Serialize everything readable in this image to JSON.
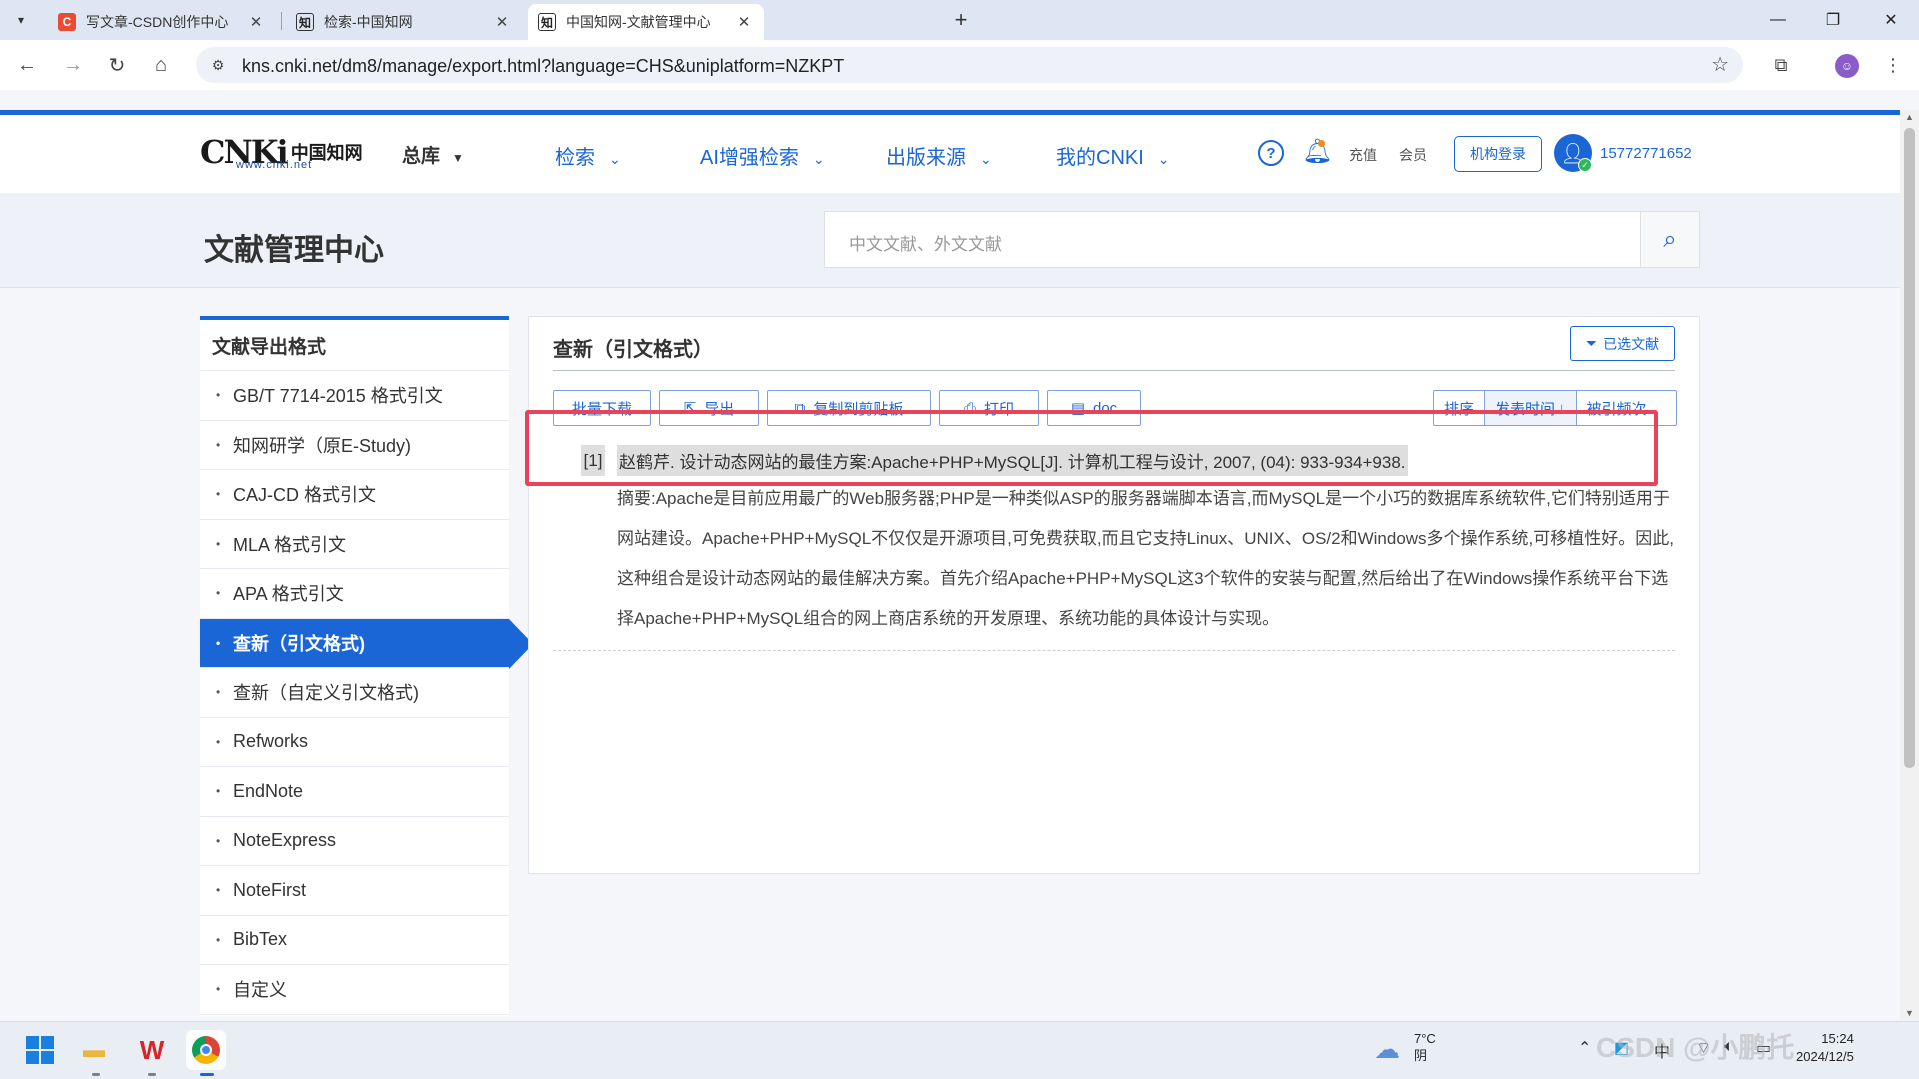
{
  "browser": {
    "tabs": [
      {
        "title": "写文章-CSDN创作中心",
        "favicon": "csdn-icon",
        "color": "#e94b35",
        "active": false
      },
      {
        "title": "检索-中国知网",
        "favicon": "cnki-icon",
        "color": "#222222",
        "active": false
      },
      {
        "title": "中国知网-文献管理中心",
        "favicon": "cnki-icon",
        "color": "#222222",
        "active": true
      }
    ],
    "url": "kns.cnki.net/dm8/manage/export.html?language=CHS&uniplatform=NZKPT"
  },
  "header": {
    "logo_mark": "CNKi",
    "logo_cn": "中国知网",
    "logo_domain": "www.cnki.net",
    "library_selector": "总库",
    "nav": [
      "检索",
      "AI增强检索",
      "出版来源",
      "我的CNKI"
    ],
    "recharge": "充值",
    "member": "会员",
    "org_login": "机构登录",
    "username": "15772771652"
  },
  "banner": {
    "title": "文献管理中心",
    "search_placeholder": "中文文献、外文文献"
  },
  "sidebar": {
    "heading": "文献导出格式",
    "items": [
      "GB/T 7714-2015 格式引文",
      "知网研学（原E-Study)",
      "CAJ-CD 格式引文",
      "MLA 格式引文",
      "APA 格式引文",
      "查新（引文格式)",
      "查新（自定义引文格式)",
      "Refworks",
      "EndNote",
      "NoteExpress",
      "NoteFirst",
      "BibTex",
      "自定义"
    ],
    "active_index": 5
  },
  "panel": {
    "title": "查新（引文格式）",
    "selected_docs": "已选文献",
    "toolbar": {
      "batch_download": "批量下载",
      "export": "导出",
      "copy_clipboard": "复制到剪贴板",
      "print": "打印",
      "doc": "doc"
    },
    "sort": {
      "label": "排序",
      "pub_time": "发表时间",
      "cited": "被引频次"
    },
    "record": {
      "index": "[1]",
      "citation": "赵鹤芹. 设计动态网站的最佳方案:Apache+PHP+MySQL[J]. 计算机工程与设计, 2007, (04): 933-934+938.",
      "abstract": "摘要:Apache是目前应用最广的Web服务器;PHP是一种类似ASP的服务器端脚本语言,而MySQL是一个小巧的数据库系统软件,它们特别适用于网站建设。Apache+PHP+MySQL不仅仅是开源项目,可免费获取,而且它支持Linux、UNIX、OS/2和Windows多个操作系统,可移植性好。因此,这种组合是设计动态网站的最佳解决方案。首先介绍Apache+PHP+MySQL这3个软件的安装与配置,然后给出了在Windows操作系统平台下选择Apache+PHP+MySQL组合的网上商店系统的开发原理、系统功能的具体设计与实现。"
    }
  },
  "taskbar": {
    "weather_temp": "7°C",
    "weather_desc": "阴",
    "ime": "中",
    "time": "15:24",
    "date": "2024/12/5",
    "watermark": "CSDN @小鹏托"
  },
  "colors": {
    "accent": "#1a66d6",
    "highlight_box": "#e8435b"
  }
}
